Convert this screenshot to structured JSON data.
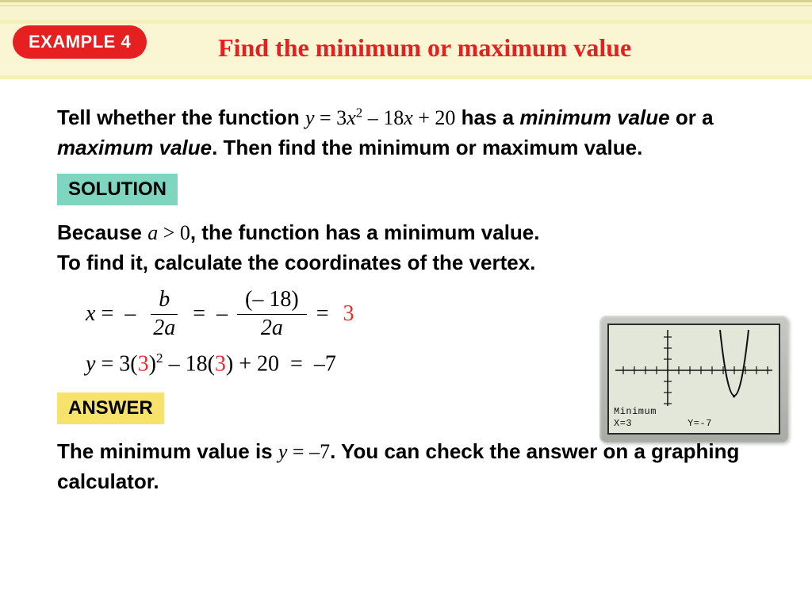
{
  "badge": "EXAMPLE 4",
  "title": "Find the minimum or maximum value",
  "problem": {
    "p1a": "Tell whether the function ",
    "eqn": "y = 3x² – 18x + 20",
    "p1b": " has a ",
    "p2a": "minimum value",
    "p2b": " or a ",
    "p2c": "maximum value",
    "p2d": ". Then find the minimum or maximum value."
  },
  "solution_label": "SOLUTION",
  "solution": {
    "s1a": "Because ",
    "cond": "a > 0",
    "s1b": ", the function has a minimum value.",
    "s2": "To find it, calculate the coordinates of the vertex."
  },
  "vertex": {
    "x_eq": "x = –",
    "frac1_num": "b",
    "frac1_den": "2a",
    "eq2": "=  –",
    "frac2_num": "(– 18)",
    "frac2_den": "2a",
    "eq3": "=",
    "x_result": "3"
  },
  "yline": {
    "a": "y = 3(",
    "r1": "3",
    "b": ")² – 18(",
    "r2": "3",
    "c": ") + 20  =  –7"
  },
  "answer_label": "ANSWER",
  "final": {
    "f1": "The minimum value is ",
    "eqn": "y = –7",
    "f2": ". You can check the answer on a graphing calculator."
  },
  "calc": {
    "line1": "Minimum",
    "line2a": "X=3",
    "line2b": "Y=-7"
  }
}
